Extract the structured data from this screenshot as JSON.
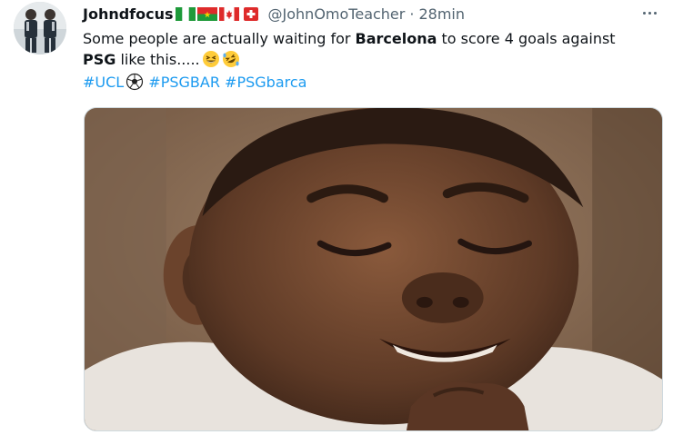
{
  "tweet": {
    "display_name": "Johndfocus",
    "flags": [
      "nigeria-flag",
      "burkina-faso-flag",
      "canada-flag",
      "switzerland-flag"
    ],
    "handle": "@JohnOmoTeacher",
    "separator": "·",
    "time": "28min",
    "text": {
      "part1": "Some people are actually waiting for ",
      "bold1": "Barcelona",
      "part2": " to score 4 goals against ",
      "bold2": "PSG",
      "part3": " like this.....",
      "emojis": [
        "grinning-squinting-face-emoji",
        "rolling-on-floor-laughing-emoji"
      ]
    },
    "hashtags": {
      "tag1": "#UCL",
      "soccer_emoji": "soccer-ball-emoji",
      "tag2": "#PSGBAR",
      "tag3": "#PSGbarca"
    },
    "media": {
      "description_icon": "photo"
    }
  },
  "colors": {
    "text": "#0f1419",
    "secondary": "#536471",
    "link": "#1d9bf0",
    "border": "#cfd9de"
  }
}
